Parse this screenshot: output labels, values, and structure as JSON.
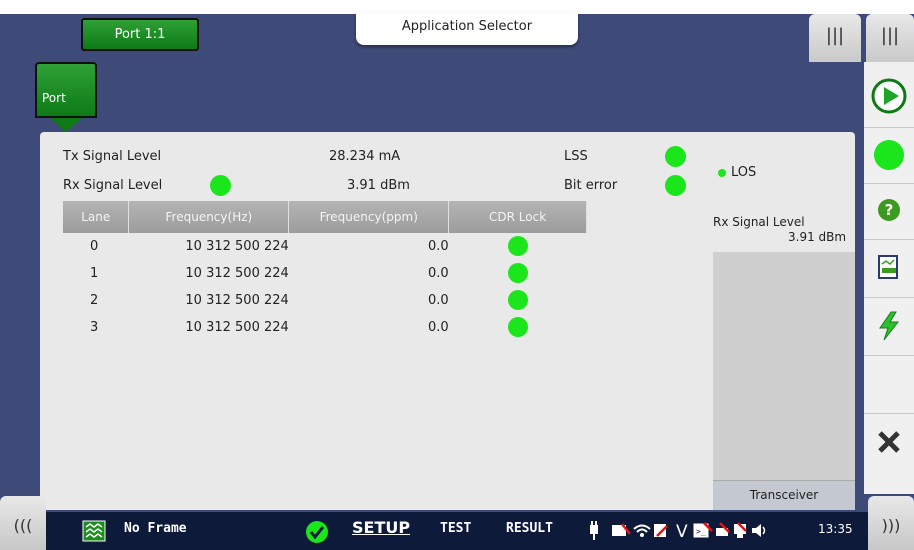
{
  "header": {
    "port_tab": "Port 1:1",
    "app_selector": "Application Selector",
    "menu_icon": "|||"
  },
  "subtab": {
    "label": "Port"
  },
  "signals": {
    "tx_label": "Tx Signal Level",
    "tx_value": "28.234 mA",
    "rx_label": "Rx Signal Level",
    "rx_value": "3.91 dBm",
    "lss_label": "LSS",
    "bit_error_label": "Bit error",
    "los_label": "LOS"
  },
  "table": {
    "headers": [
      "Lane",
      "Frequency(Hz)",
      "Frequency(ppm)",
      "CDR Lock"
    ],
    "rows": [
      {
        "lane": "0",
        "freq": "10 312 500 224",
        "ppm": "0.0"
      },
      {
        "lane": "1",
        "freq": "10 312 500 224",
        "ppm": "0.0"
      },
      {
        "lane": "2",
        "freq": "10 312 500 224",
        "ppm": "0.0"
      },
      {
        "lane": "3",
        "freq": "10 312 500 224",
        "ppm": "0.0"
      }
    ]
  },
  "side": {
    "title": "Rx Signal Level",
    "value": "3.91 dBm",
    "transceiver": "Transceiver"
  },
  "bottom": {
    "left_btn": "(((",
    "right_btn": ")))",
    "frame": "No Frame",
    "setup": "SETUP",
    "test": "TEST",
    "result": "RESULT",
    "time": "13:35"
  },
  "colors": {
    "led_on": "#1be51b",
    "accent": "#3e4a78",
    "tab_green": "#0d7a16"
  }
}
